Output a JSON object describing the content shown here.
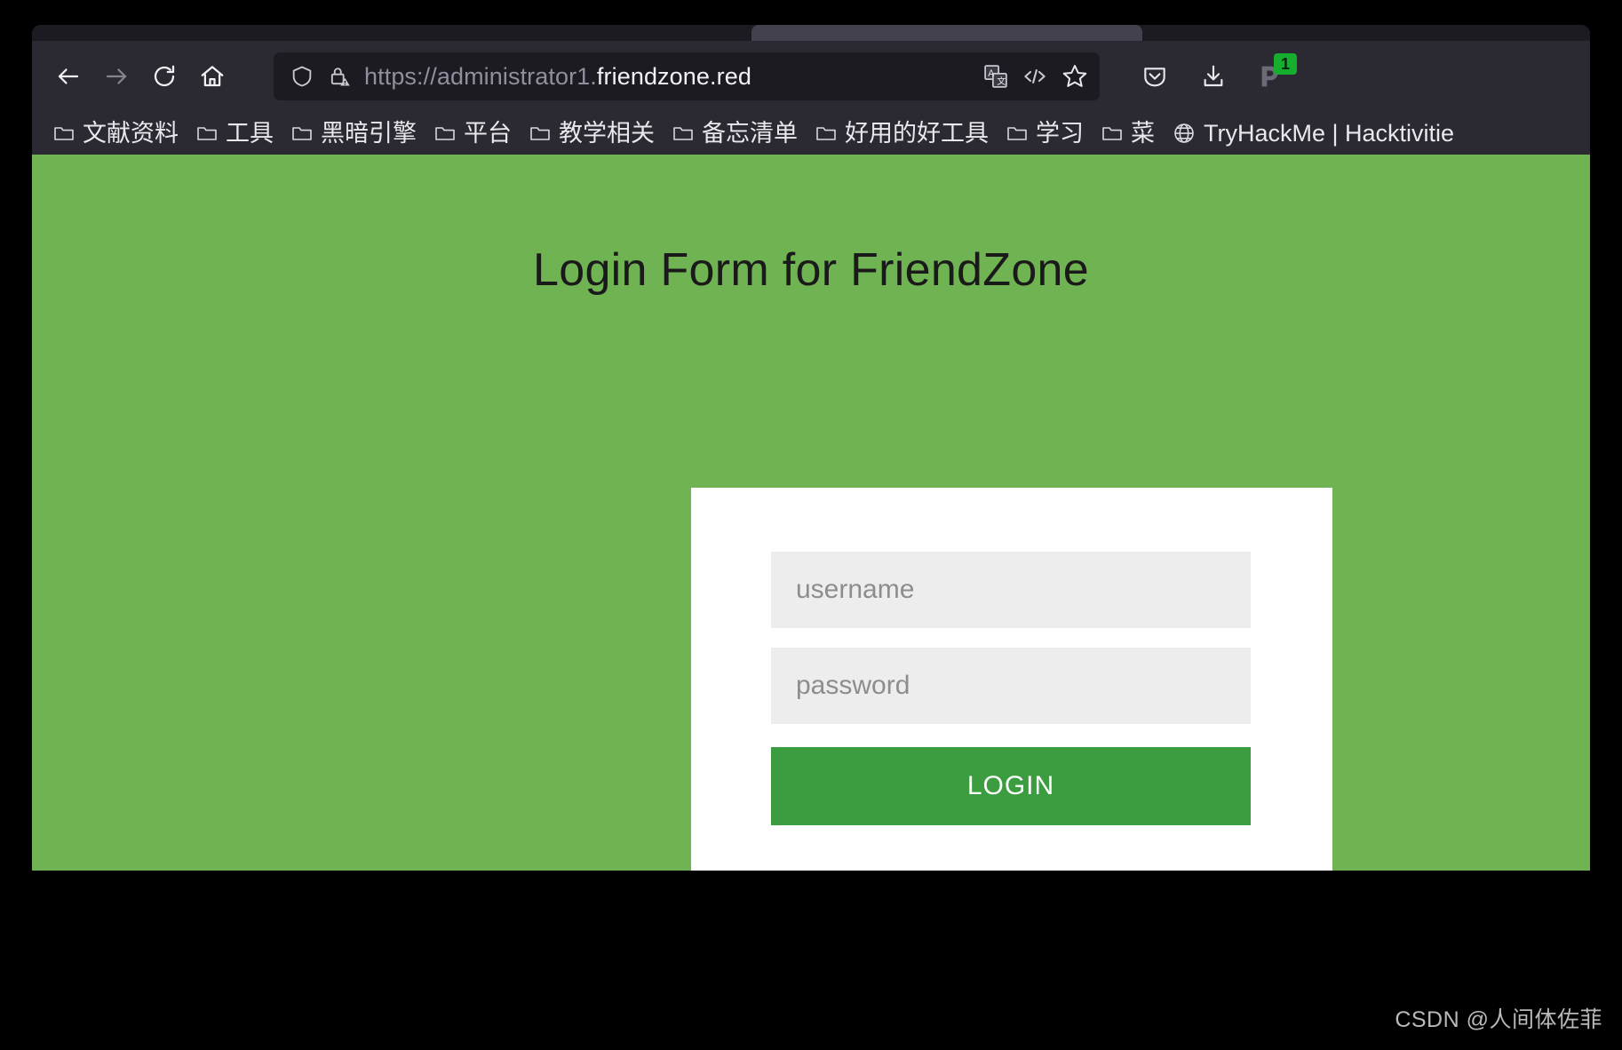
{
  "browser": {
    "nav": {
      "back": "back-arrow",
      "forward": "forward-arrow",
      "reload": "reload",
      "home": "home"
    },
    "address_bar": {
      "scheme": "https://",
      "subdomain": "administrator1.",
      "host": "friendzone.red",
      "full_url": "https://administrator1.friendzone.red",
      "shield_icon": "tracking-protection-shield",
      "lock_icon": "insecure-lock-warning",
      "translate_icon": "translate-page",
      "reader_icon": "code-view",
      "bookmark_icon": "bookmark-star"
    },
    "toolbar": {
      "pocket_label": "pocket-save",
      "downloads_label": "downloads",
      "extension_label": "extension",
      "extension_badge": "1"
    },
    "bookmarks": [
      {
        "label": "文献资料",
        "icon": "folder-icon"
      },
      {
        "label": "工具",
        "icon": "folder-icon"
      },
      {
        "label": "黑暗引擎",
        "icon": "folder-icon"
      },
      {
        "label": "平台",
        "icon": "folder-icon"
      },
      {
        "label": "教学相关",
        "icon": "folder-icon"
      },
      {
        "label": "备忘清单",
        "icon": "folder-icon"
      },
      {
        "label": "好用的好工具",
        "icon": "folder-icon"
      },
      {
        "label": "学习",
        "icon": "folder-icon"
      },
      {
        "label": "菜",
        "icon": "folder-icon"
      },
      {
        "label": "TryHackMe | Hacktivitie",
        "icon": "globe-icon"
      }
    ]
  },
  "page": {
    "title": "Login Form for FriendZone",
    "form": {
      "username_placeholder": "username",
      "username_value": "",
      "password_placeholder": "password",
      "password_value": "",
      "submit_label": "LOGIN"
    },
    "colors": {
      "background_green": "#70b353",
      "button_green": "#3c9c40",
      "card_white": "#ffffff",
      "field_grey": "#ededed"
    }
  },
  "watermark": {
    "text": "CSDN @人间体佐菲"
  }
}
